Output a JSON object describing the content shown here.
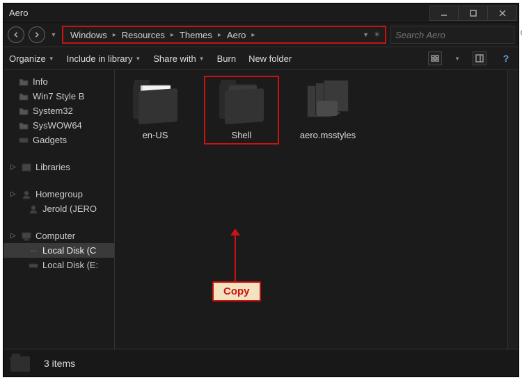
{
  "window": {
    "title": "Aero"
  },
  "breadcrumb": {
    "items": [
      "Windows",
      "Resources",
      "Themes",
      "Aero"
    ]
  },
  "search": {
    "placeholder": "Search Aero"
  },
  "toolbar": {
    "organize": "Organize",
    "include": "Include in library",
    "share": "Share with",
    "burn": "Burn",
    "newfolder": "New folder"
  },
  "sidebar": {
    "tree": {
      "info": "Info",
      "win7": "Win7 Style B",
      "system32": "System32",
      "syswow64": "SysWOW64",
      "gadgets": "Gadgets"
    },
    "libraries": "Libraries",
    "homegroup": "Homegroup",
    "homegroup_user": "Jerold (JERO",
    "computer": "Computer",
    "localc": "Local Disk (C",
    "locale": "Local Disk (E:"
  },
  "items": {
    "enus": "en-US",
    "shell": "Shell",
    "aerofile": "aero.msstyles"
  },
  "annotation": {
    "copy": "Copy"
  },
  "status": {
    "count": "3 items"
  }
}
